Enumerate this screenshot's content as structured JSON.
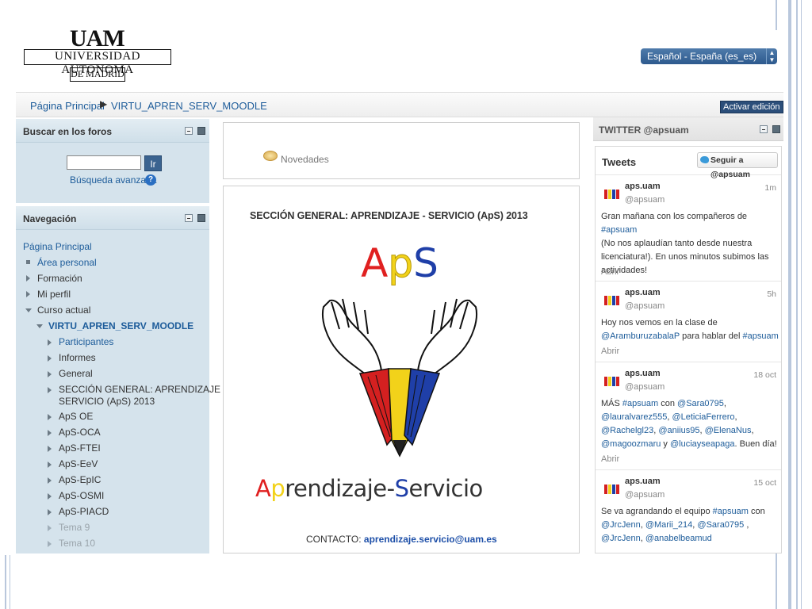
{
  "header": {
    "logo": {
      "top": "UAM",
      "name": "UNIVERSIDAD AUTONOMA",
      "sub": "DE MADRID"
    },
    "language": "Español - España (es_es)"
  },
  "breadcrumb": {
    "home": "Página Principal",
    "course": "VIRTU_APREN_SERV_MOODLE"
  },
  "edit_button": "Activar edición",
  "forum_search": {
    "title": "Buscar en los foros",
    "go_label": "Ir",
    "advanced_label": "Búsqueda avanzada",
    "help_label": "?"
  },
  "navigation": {
    "title": "Navegación",
    "home": "Página Principal",
    "items": [
      "Área personal",
      "Formación",
      "Mi perfil",
      "Curso actual"
    ],
    "course": "VIRTU_APREN_SERV_MOODLE",
    "course_items": [
      "Participantes",
      "Informes",
      "General",
      "SECCIÓN GENERAL: APRENDIZAJE -",
      "SERVICIO (ApS) 2013",
      "ApS OE",
      "ApS-OCA",
      "ApS-FTEI",
      "ApS-EeV",
      "ApS-EpIC",
      "ApS-OSMI",
      "ApS-PIACD",
      "Tema 9",
      "Tema 10"
    ]
  },
  "center": {
    "news_label": "Novedades",
    "section_title": "SECCIÓN GENERAL: APRENDIZAJE - SERVICIO (ApS) 2013",
    "logo_letters": [
      "A",
      "p",
      "S"
    ],
    "logo_colors": {
      "a": "#e02020",
      "p": "#1f3fa8",
      "s": "#1f3fa8",
      "yellow": "#f2d21a"
    },
    "wordmark": {
      "a": "A",
      "p": "p",
      "rest1": "rendizaje-",
      "s": "S",
      "rest2": "ervicio"
    },
    "contact_label": "CONTACTO:",
    "contact_email": "aprendizaje.servicio@uam.es"
  },
  "twitter": {
    "block_title": "TWITTER @apsuam",
    "tweets_title": "Tweets",
    "follow_label": "Seguir a @apsuam",
    "open_label": "Abrir",
    "tweets": [
      {
        "name": "aps.uam",
        "handle": "@apsuam",
        "time": "1m",
        "lines": [
          [
            "Gran mañana con los compañeros de ",
            "#apsuam"
          ],
          [
            "(No nos aplaudían tanto desde nuestra"
          ],
          [
            "licenciatura!). En unos minutos subimos las"
          ],
          [
            "actividades!"
          ]
        ]
      },
      {
        "name": "aps.uam",
        "handle": "@apsuam",
        "time": "5h",
        "lines": [
          [
            "Hoy nos vemos en la clase de"
          ],
          [
            "@AramburuzabalaP",
            "  para hablar del ",
            "#apsuam"
          ]
        ]
      },
      {
        "name": "aps.uam",
        "handle": "@apsuam",
        "time": "18 oct",
        "lines": [
          [
            "MÁS ",
            "#apsuam",
            " con ",
            "@Sara0795",
            ","
          ],
          [
            "@lauralvarez555",
            ", ",
            "@LeticiaFerrero",
            ","
          ],
          [
            "@Rachelgl23",
            ", ",
            "@aniius95",
            ", ",
            "@ElenaNus",
            ","
          ],
          [
            "@magoozmaru",
            " y ",
            "@luciayseapaga",
            ". Buen día!"
          ]
        ]
      },
      {
        "name": "aps.uam",
        "handle": "@apsuam",
        "time": "15 oct",
        "lines": [
          [
            "Se va agrandando el equipo ",
            "#apsuam",
            " con"
          ],
          [
            "@JrcJenn",
            ",  ",
            "@Marii_214",
            ", ",
            "@Sara0795",
            " ,"
          ],
          [
            "@JrcJenn",
            ", ",
            "@anabelbeamud"
          ]
        ]
      }
    ]
  }
}
